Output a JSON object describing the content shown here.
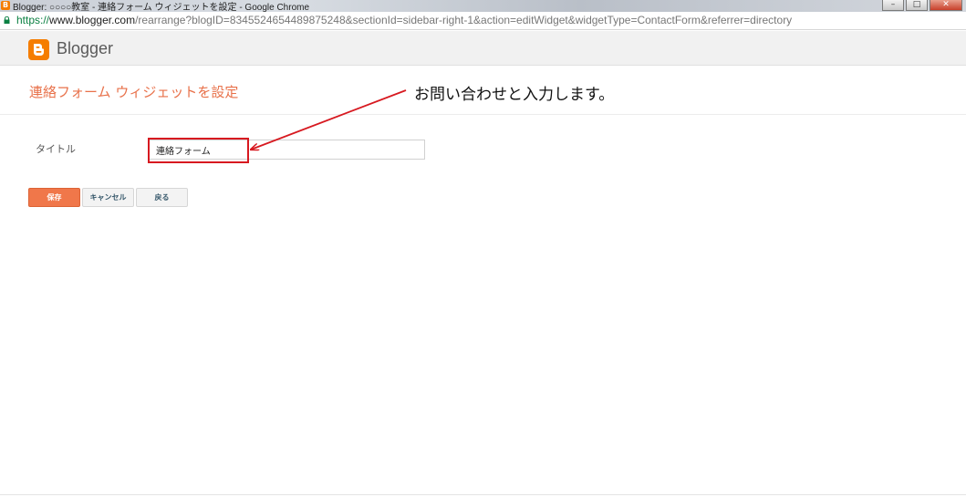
{
  "window": {
    "title": "Blogger: ○○○○教室 - 連絡フォーム ウィジェットを設定 - Google Chrome",
    "favicon_letter": "B",
    "minimize_glyph": "–",
    "maximize_glyph": "□",
    "close_glyph": "✕"
  },
  "address": {
    "scheme": "https://",
    "host": "www.blogger.com",
    "path": "/rearrange?blogID=8345524654489875248&sectionId=sidebar-right-1&action=editWidget&widgetType=ContactForm&referrer=directory"
  },
  "header": {
    "logo_text": "Blogger",
    "brand_color": "#f57d00"
  },
  "page": {
    "title": "連絡フォーム ウィジェットを設定"
  },
  "form": {
    "title_label": "タイトル",
    "title_value": "連絡フォーム"
  },
  "buttons": {
    "save": "保存",
    "cancel": "キャンセル",
    "back": "戻る"
  },
  "annotation": {
    "text": "お問い合わせと入力します。",
    "color": "#d71920"
  }
}
